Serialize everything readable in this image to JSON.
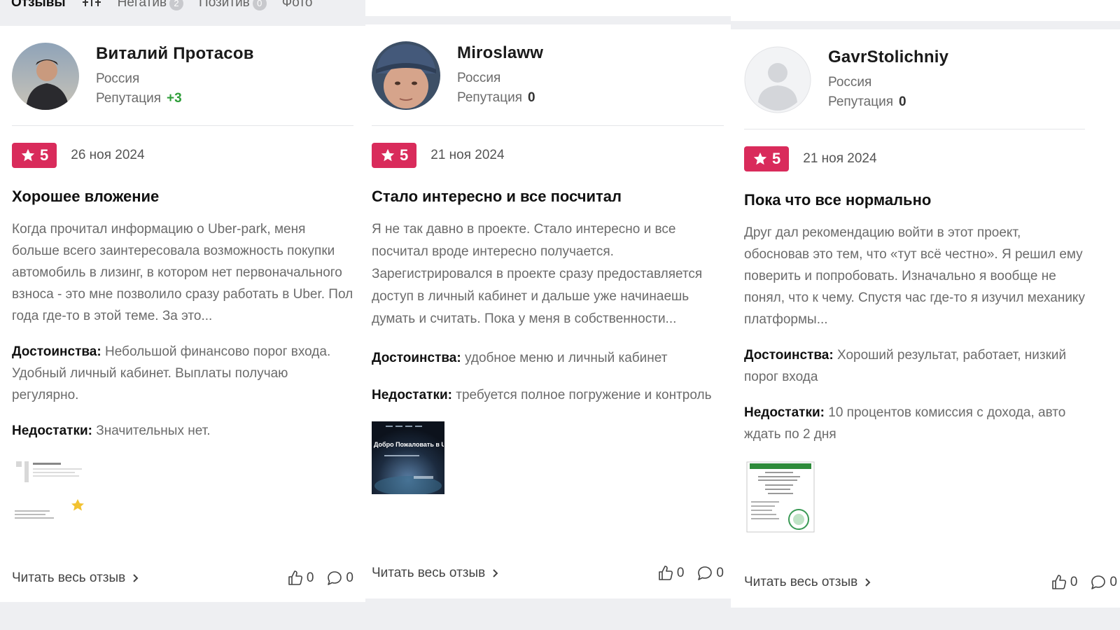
{
  "tabs": {
    "reviews": "Отзывы",
    "negative": "Негатив",
    "negative_count": "2",
    "positive": "Позитив",
    "positive_count": "0",
    "photo": "Фото"
  },
  "reviews": [
    {
      "name": "Виталий Протасов",
      "country": "Россия",
      "rep_label": "Репутация",
      "rep_value": "+3",
      "rating": "5",
      "date": "26 ноя 2024",
      "title": "Хорошее вложение",
      "text": "Когда прочитал информацию о Uber-park, меня больше всего заинтересовала возможность покупки автомобиль в лизинг, в котором нет первоначального взноса - это мне позволило сразу работать в Uber. Пол года где-то в этой теме. За это...",
      "pros_label": "Достоинства:",
      "pros": "Небольшой финансово порог входа. Удобный личный кабинет. Выплаты получаю регулярно.",
      "cons_label": "Недостатки:",
      "cons": "Значительных нет.",
      "read_more": "Читать весь отзыв",
      "likes": "0",
      "comments": "0"
    },
    {
      "name": "Miroslaww",
      "country": "Россия",
      "rep_label": "Репутация",
      "rep_value": "0",
      "rating": "5",
      "date": "21 ноя 2024",
      "title": "Стало интересно и все посчитал",
      "text": "Я не так давно в проекте. Стало интересно и все посчитал вроде интересно получается. Зарегистрировался в проекте сразу предоставляется доступ в личный кабинет и дальше уже начинаешь думать и считать. Пока у меня в собственности...",
      "pros_label": "Достоинства:",
      "pros": "удобное меню и личный кабинет",
      "cons_label": "Недостатки:",
      "cons": "требуется полное погружение и контроль",
      "thumb_text": "Добро Пожаловать в U",
      "read_more": "Читать весь отзыв",
      "likes": "0",
      "comments": "0"
    },
    {
      "name": "GavrStolichniy",
      "country": "Россия",
      "rep_label": "Репутация",
      "rep_value": "0",
      "rating": "5",
      "date": "21 ноя 2024",
      "title": "Пока что все нормально",
      "text": "Друг дал рекомендацию войти в этот проект, обосновав это тем, что «тут всё честно». Я решил ему поверить и попробовать. Изначально я вообще не понял, что к чему. Спустя час где-то я изучил механику платформы...",
      "pros_label": "Достоинства:",
      "pros": "Хороший результат, работает, низкий порог входа",
      "cons_label": "Недостатки:",
      "cons": "10 процентов комиссия с дохода, авто ждать по 2 дня",
      "read_more": "Читать весь отзыв",
      "likes": "0",
      "comments": "0"
    }
  ],
  "colors": {
    "badge": "#d92b5b",
    "positive_rep": "#2f9e3a"
  }
}
